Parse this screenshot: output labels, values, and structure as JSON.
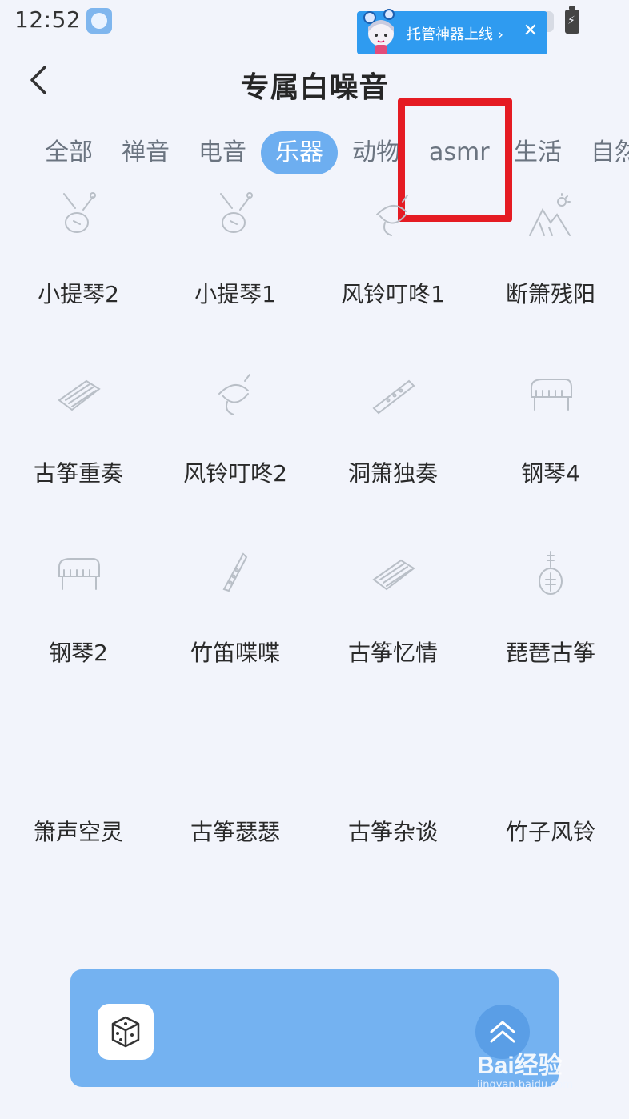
{
  "status_bar": {
    "time": "12:52"
  },
  "promo_banner": {
    "text": "托管神器上线",
    "chevron": "›",
    "close": "✕"
  },
  "header": {
    "title": "专属白噪音",
    "back_icon": "chevron-left-icon"
  },
  "tabs": [
    {
      "label": "全部",
      "active": false
    },
    {
      "label": "禅音",
      "active": false
    },
    {
      "label": "电音",
      "active": false
    },
    {
      "label": "乐器",
      "active": true
    },
    {
      "label": "动物",
      "active": false
    },
    {
      "label": "asmr",
      "active": false
    },
    {
      "label": "生活",
      "active": false
    },
    {
      "label": "自然",
      "active": false
    }
  ],
  "sounds": [
    {
      "label": "小提琴2",
      "icon": "violin-icon"
    },
    {
      "label": "小提琴1",
      "icon": "violin-icon"
    },
    {
      "label": "风铃叮咚1",
      "icon": "wind-chime-icon"
    },
    {
      "label": "断箫残阳",
      "icon": "mountain-sun-icon"
    },
    {
      "label": "古筝重奏",
      "icon": "guzheng-icon"
    },
    {
      "label": "风铃叮咚2",
      "icon": "wind-chime-icon"
    },
    {
      "label": "洞箫独奏",
      "icon": "flute-icon"
    },
    {
      "label": "钢琴4",
      "icon": "piano-icon"
    },
    {
      "label": "钢琴2",
      "icon": "piano-icon"
    },
    {
      "label": "竹笛喋喋",
      "icon": "clarinet-icon"
    },
    {
      "label": "古筝忆情",
      "icon": "guzheng-icon"
    },
    {
      "label": "琵琶古筝",
      "icon": "pipa-icon"
    },
    {
      "label": "箫声空灵",
      "icon": ""
    },
    {
      "label": "古筝瑟瑟",
      "icon": ""
    },
    {
      "label": "古筝杂谈",
      "icon": ""
    },
    {
      "label": "竹子风铃",
      "icon": ""
    }
  ],
  "player": {
    "dice_icon": "dice-icon",
    "expand_icon": "double-chevron-up-icon"
  },
  "watermark": {
    "main": "Bai经验",
    "sub": "jingyan.baidu.com"
  },
  "colors": {
    "accent": "#6daef0",
    "player": "#74b2f1",
    "highlight": "#e51b23",
    "background": "#f2f4fb"
  }
}
